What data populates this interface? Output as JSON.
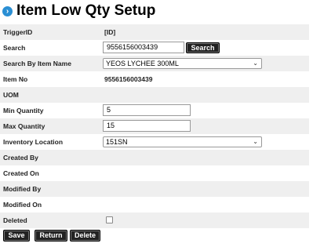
{
  "header": {
    "title": "Item Low Qty Setup",
    "icon": "chevron-right-circle-icon",
    "icon_glyph": "›",
    "accent_color": "#2a8fd4"
  },
  "form": {
    "trigger_id": {
      "label": "TriggerID",
      "value": "[ID]"
    },
    "search": {
      "label": "Search",
      "value": "9556156003439",
      "button": "Search"
    },
    "search_by_item_name": {
      "label": "Search By Item Name",
      "selected": "YEOS LYCHEE 300ML"
    },
    "item_no": {
      "label": "Item No",
      "value": "9556156003439"
    },
    "uom": {
      "label": "UOM",
      "value": ""
    },
    "min_quantity": {
      "label": "Min Quantity",
      "value": "5"
    },
    "max_quantity": {
      "label": "Max Quantity",
      "value": "15"
    },
    "inventory_location": {
      "label": "Inventory Location",
      "selected": "151SN"
    },
    "created_by": {
      "label": "Created By",
      "value": ""
    },
    "created_on": {
      "label": "Created On",
      "value": ""
    },
    "modified_by": {
      "label": "Modified By",
      "value": ""
    },
    "modified_on": {
      "label": "Modified On",
      "value": ""
    },
    "deleted": {
      "label": "Deleted",
      "checked": false
    }
  },
  "actions": {
    "save": "Save",
    "return": "Return",
    "delete": "Delete"
  }
}
